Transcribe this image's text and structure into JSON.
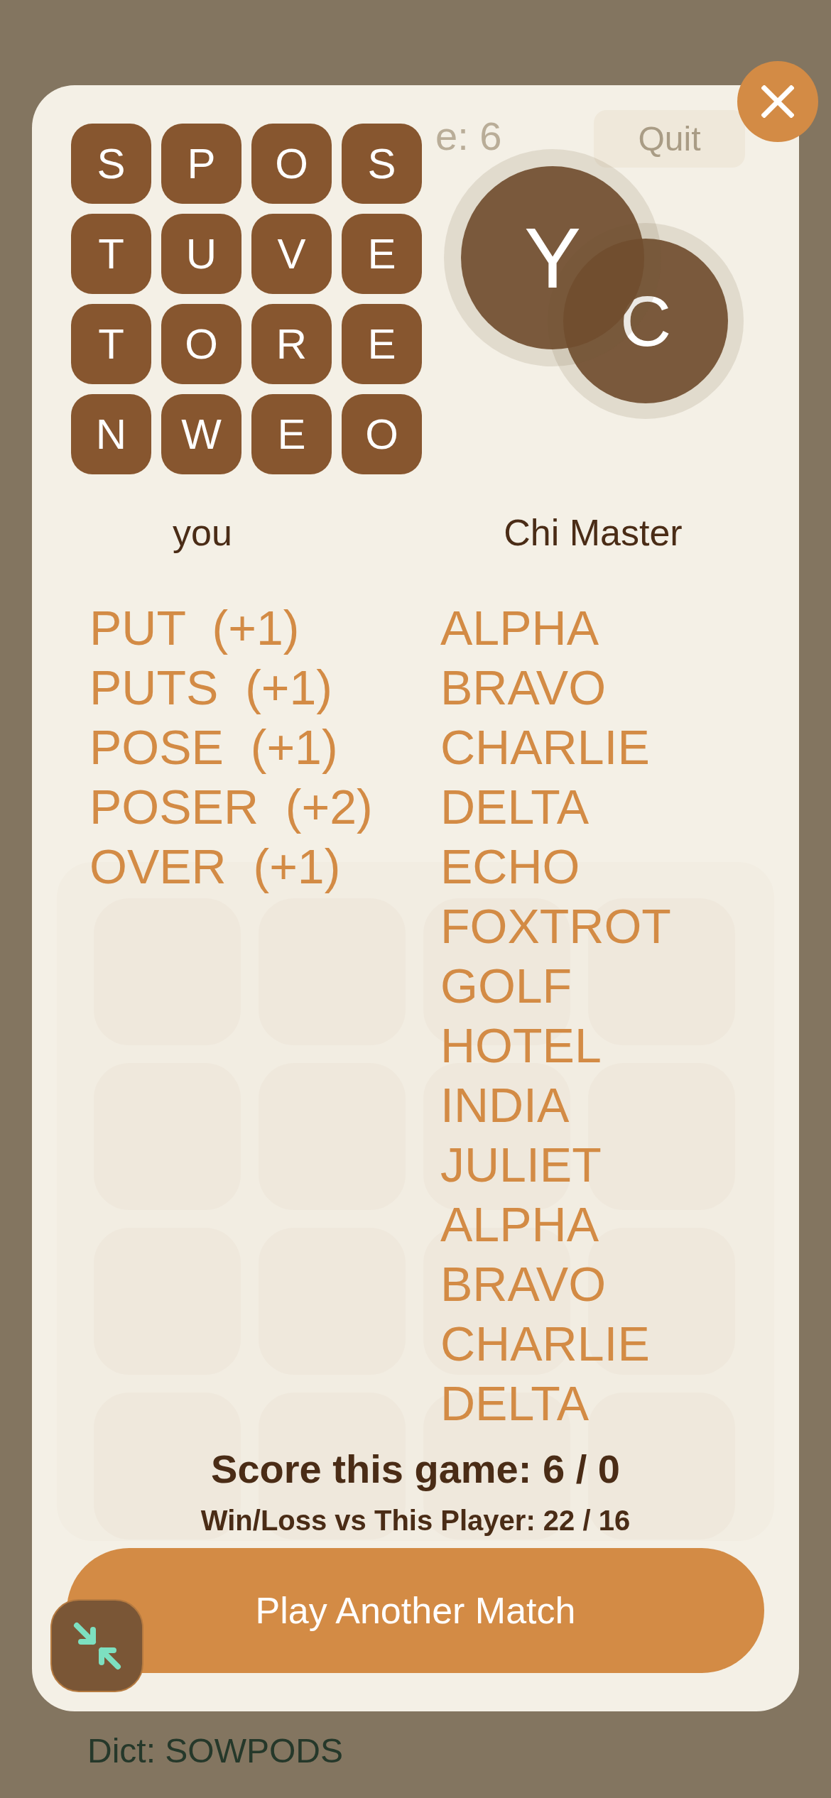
{
  "background_game": {
    "score_fragment": "e: 6",
    "quit_button": "Quit"
  },
  "board": [
    "S",
    "P",
    "O",
    "S",
    "T",
    "U",
    "V",
    "E",
    "T",
    "O",
    "R",
    "E",
    "N",
    "W",
    "E",
    "O"
  ],
  "avatars": [
    {
      "initial": "Y"
    },
    {
      "initial": "C"
    }
  ],
  "players": [
    {
      "name": "you",
      "words": [
        "PUT  (+1)",
        "PUTS  (+1)",
        "POSE  (+1)",
        "POSER  (+2)",
        "OVER  (+1)"
      ]
    },
    {
      "name": "Chi Master",
      "words": [
        "ALPHA",
        "BRAVO",
        "CHARLIE",
        "DELTA",
        "ECHO",
        "FOXTROT",
        "GOLF",
        "HOTEL",
        "INDIA",
        "JULIET",
        "ALPHA",
        "BRAVO",
        "CHARLIE",
        "DELTA"
      ]
    }
  ],
  "score_line": "Score this game: 6 / 0",
  "record_line": "Win/Loss vs This Player:  22 / 16",
  "play_button": "Play Another Match",
  "dictionary": "Dict: SOWPODS"
}
